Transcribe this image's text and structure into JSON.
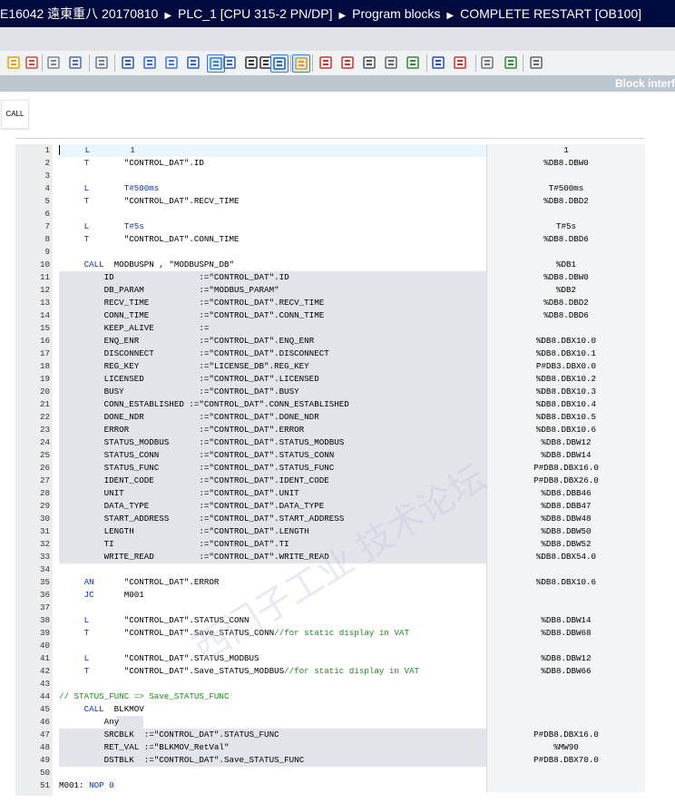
{
  "breadcrumb": [
    "E16042 遠東重八 20170810",
    "PLC_1 [CPU 315-2 PN/DP]",
    "Program blocks",
    "COMPLETE RESTART [OB100]"
  ],
  "block_interface_label": "Block interf",
  "favorites": {
    "call_label": "CALL"
  },
  "toolbar_icons": [
    "insert-network-icon",
    "delete-network-icon",
    "insert-row-icon",
    "comment-icon",
    "download-icon",
    "stl-list-icon",
    "view-a-icon",
    "view-b-icon",
    "view-c-icon",
    "speech-icon",
    "jump-icon",
    "jump-down-icon",
    "lines-icon",
    "lines-sel-icon",
    "goto-icon",
    "bp-set-icon",
    "bp-clear-icon",
    "monitor-icon",
    "watch-icon",
    "check-icon",
    "insert-label-icon",
    "branch-icon",
    "tool-icon",
    "sim-icon",
    "collapse-icon"
  ],
  "lines": [
    {
      "n": "1",
      "t": [
        [
          "L",
          "op"
        ],
        [
          "        1",
          "lit"
        ]
      ],
      "v": "1",
      "pad": "     "
    },
    {
      "n": "2",
      "t": [
        [
          "T",
          "op"
        ],
        [
          "       \"CONTROL_DAT\".ID",
          ""
        ]
      ],
      "v": "%DB8.DBW0",
      "pad": "     "
    },
    {
      "n": "3",
      "t": [],
      "v": "",
      "pad": ""
    },
    {
      "n": "4",
      "t": [
        [
          "L",
          "op"
        ],
        [
          "       T#500ms",
          "lit"
        ]
      ],
      "v": "T#500ms",
      "pad": "     "
    },
    {
      "n": "5",
      "t": [
        [
          "T",
          "op"
        ],
        [
          "       \"CONTROL_DAT\".RECV_TIME",
          ""
        ]
      ],
      "v": "%DB8.DBD2",
      "pad": "     "
    },
    {
      "n": "6",
      "t": [],
      "v": "",
      "pad": ""
    },
    {
      "n": "7",
      "t": [
        [
          "L",
          "op"
        ],
        [
          "       T#5s",
          "lit"
        ]
      ],
      "v": "T#5s",
      "pad": "     "
    },
    {
      "n": "8",
      "t": [
        [
          "T",
          "op"
        ],
        [
          "       \"CONTROL_DAT\".CONN_TIME",
          ""
        ]
      ],
      "v": "%DB8.DBD6",
      "pad": "     "
    },
    {
      "n": "9",
      "t": [],
      "v": "",
      "pad": ""
    },
    {
      "n": "10",
      "t": [
        [
          "CALL",
          "op"
        ],
        [
          "  MODBUSPN , \"MODBUSPN_DB\"",
          ""
        ]
      ],
      "v": "%DB1",
      "pad": "     "
    },
    {
      "n": "11",
      "t": [
        [
          "ID                 :=\"CONTROL_DAT\".ID",
          ""
        ]
      ],
      "v": "%DB8.DBW0",
      "pad": "         ",
      "hl": true
    },
    {
      "n": "12",
      "t": [
        [
          "DB_PARAM           :=\"MODBUS_PARAM\"",
          ""
        ]
      ],
      "v": "%DB2",
      "pad": "         ",
      "hl": true
    },
    {
      "n": "13",
      "t": [
        [
          "RECV_TIME          :=\"CONTROL_DAT\".RECV_TIME",
          ""
        ]
      ],
      "v": "%DB8.DBD2",
      "pad": "         ",
      "hl": true
    },
    {
      "n": "14",
      "t": [
        [
          "CONN_TIME          :=\"CONTROL_DAT\".CONN_TIME",
          ""
        ]
      ],
      "v": "%DB8.DBD6",
      "pad": "         ",
      "hl": true
    },
    {
      "n": "15",
      "t": [
        [
          "KEEP_ALIVE         :=",
          ""
        ]
      ],
      "v": "",
      "pad": "         ",
      "hl": true
    },
    {
      "n": "16",
      "t": [
        [
          "ENQ_ENR            :=\"CONTROL_DAT\".ENQ_ENR",
          ""
        ]
      ],
      "v": "%DB8.DBX10.0",
      "pad": "         ",
      "hl": true
    },
    {
      "n": "17",
      "t": [
        [
          "DISCONNECT         :=\"CONTROL_DAT\".DISCONNECT",
          ""
        ]
      ],
      "v": "%DB8.DBX10.1",
      "pad": "         ",
      "hl": true
    },
    {
      "n": "18",
      "t": [
        [
          "REG_KEY            :=\"LICENSE_DB\".REG_KEY",
          ""
        ]
      ],
      "v": "P#DB3.DBX0.0",
      "pad": "         ",
      "hl": true
    },
    {
      "n": "19",
      "t": [
        [
          "LICENSED           :=\"CONTROL_DAT\".LICENSED",
          ""
        ]
      ],
      "v": "%DB8.DBX10.2",
      "pad": "         ",
      "hl": true
    },
    {
      "n": "20",
      "t": [
        [
          "BUSY               :=\"CONTROL_DAT\".BUSY",
          ""
        ]
      ],
      "v": "%DB8.DBX10.3",
      "pad": "         ",
      "hl": true
    },
    {
      "n": "21",
      "t": [
        [
          "CONN_ESTABLISHED :=\"CONTROL_DAT\".CONN_ESTABLISHED",
          ""
        ]
      ],
      "v": "%DB8.DBX10.4",
      "pad": "         ",
      "hl": true
    },
    {
      "n": "22",
      "t": [
        [
          "DONE_NDR           :=\"CONTROL_DAT\".DONE_NDR",
          ""
        ]
      ],
      "v": "%DB8.DBX10.5",
      "pad": "         ",
      "hl": true
    },
    {
      "n": "23",
      "t": [
        [
          "ERROR              :=\"CONTROL_DAT\".ERROR",
          ""
        ]
      ],
      "v": "%DB8.DBX10.6",
      "pad": "         ",
      "hl": true
    },
    {
      "n": "24",
      "t": [
        [
          "STATUS_MODBUS      :=\"CONTROL_DAT\".STATUS_MODBUS",
          ""
        ]
      ],
      "v": "%DB8.DBW12",
      "pad": "         ",
      "hl": true
    },
    {
      "n": "25",
      "t": [
        [
          "STATUS_CONN        :=\"CONTROL_DAT\".STATUS_CONN",
          ""
        ]
      ],
      "v": "%DB8.DBW14",
      "pad": "         ",
      "hl": true
    },
    {
      "n": "26",
      "t": [
        [
          "STATUS_FUNC        :=\"CONTROL_DAT\".STATUS_FUNC",
          ""
        ]
      ],
      "v": "P#DB8.DBX16.0",
      "pad": "         ",
      "hl": true
    },
    {
      "n": "27",
      "t": [
        [
          "IDENT_CODE         :=\"CONTROL_DAT\".IDENT_CODE",
          ""
        ]
      ],
      "v": "P#DB8.DBX26.0",
      "pad": "         ",
      "hl": true
    },
    {
      "n": "28",
      "t": [
        [
          "UNIT               :=\"CONTROL_DAT\".UNIT",
          ""
        ]
      ],
      "v": "%DB8.DBB46",
      "pad": "         ",
      "hl": true
    },
    {
      "n": "29",
      "t": [
        [
          "DATA_TYPE          :=\"CONTROL_DAT\".DATA_TYPE",
          ""
        ]
      ],
      "v": "%DB8.DBB47",
      "pad": "         ",
      "hl": true
    },
    {
      "n": "30",
      "t": [
        [
          "START_ADDRESS      :=\"CONTROL_DAT\".START_ADDRESS",
          ""
        ]
      ],
      "v": "%DB8.DBW48",
      "pad": "         ",
      "hl": true
    },
    {
      "n": "31",
      "t": [
        [
          "LENGTH             :=\"CONTROL_DAT\".LENGTH",
          ""
        ]
      ],
      "v": "%DB8.DBW50",
      "pad": "         ",
      "hl": true
    },
    {
      "n": "32",
      "t": [
        [
          "TI                 :=\"CONTROL_DAT\".TI",
          ""
        ]
      ],
      "v": "%DB8.DBW52",
      "pad": "         ",
      "hl": true
    },
    {
      "n": "33",
      "t": [
        [
          "WRITE_READ         :=\"CONTROL_DAT\".WRITE_READ",
          ""
        ]
      ],
      "v": "%DB8.DBX54.0",
      "pad": "         ",
      "hl": true
    },
    {
      "n": "34",
      "t": [],
      "v": "",
      "pad": ""
    },
    {
      "n": "35",
      "t": [
        [
          "AN",
          "op"
        ],
        [
          "      \"CONTROL_DAT\".ERROR",
          ""
        ]
      ],
      "v": "%DB8.DBX10.6",
      "pad": "     "
    },
    {
      "n": "36",
      "t": [
        [
          "JC",
          "op"
        ],
        [
          "      M001",
          ""
        ]
      ],
      "v": "",
      "pad": "     "
    },
    {
      "n": "37",
      "t": [],
      "v": "",
      "pad": ""
    },
    {
      "n": "38",
      "t": [
        [
          "L",
          "op"
        ],
        [
          "       \"CONTROL_DAT\".STATUS_CONN",
          ""
        ]
      ],
      "v": "%DB8.DBW14",
      "pad": "     "
    },
    {
      "n": "39",
      "t": [
        [
          "T",
          "op"
        ],
        [
          "       \"CONTROL_DAT\".Save_STATUS_CONN",
          ""
        ],
        [
          "//for static display in VAT",
          "cmt"
        ]
      ],
      "v": "%DB8.DBW68",
      "pad": "     "
    },
    {
      "n": "40",
      "t": [],
      "v": "",
      "pad": ""
    },
    {
      "n": "41",
      "t": [
        [
          "L",
          "op"
        ],
        [
          "       \"CONTROL_DAT\".STATUS_MODBUS",
          ""
        ]
      ],
      "v": "%DB8.DBW12",
      "pad": "     "
    },
    {
      "n": "42",
      "t": [
        [
          "T",
          "op"
        ],
        [
          "       \"CONTROL_DAT\".Save_STATUS_MODBUS",
          ""
        ],
        [
          "//for static display in VAT",
          "cmt"
        ]
      ],
      "v": "%DB8.DBW66",
      "pad": "     "
    },
    {
      "n": "43",
      "t": [],
      "v": "",
      "pad": ""
    },
    {
      "n": "44",
      "t": [
        [
          "// STATUS_FUNC => Save_STATUS_FUNC",
          "cmt"
        ]
      ],
      "v": "",
      "pad": ""
    },
    {
      "n": "45",
      "t": [
        [
          "CALL",
          "op"
        ],
        [
          "  BLKMOV",
          ""
        ]
      ],
      "v": "",
      "pad": "     "
    },
    {
      "n": "46",
      "t": [
        [
          "Any",
          ""
        ]
      ],
      "v": "",
      "pad": "         ",
      "hl2": true
    },
    {
      "n": "47",
      "t": [
        [
          "SRCBLK  :=\"CONTROL_DAT\".STATUS_FUNC",
          ""
        ]
      ],
      "v": "P#DB8.DBX16.0",
      "pad": "         ",
      "hl": true
    },
    {
      "n": "48",
      "t": [
        [
          "RET_VAL :=\"BLKMOV_RetVal\"",
          ""
        ]
      ],
      "v": "%MW90",
      "pad": "         ",
      "hl": true
    },
    {
      "n": "49",
      "t": [
        [
          "DSTBLK  :=\"CONTROL_DAT\".Save_STATUS_FUNC",
          ""
        ]
      ],
      "v": "P#DB8.DBX70.0",
      "pad": "         ",
      "hl": true
    },
    {
      "n": "50",
      "t": [],
      "v": "",
      "pad": ""
    },
    {
      "n": "51",
      "t": [
        [
          "M001: ",
          ""
        ],
        [
          "NOP",
          "op"
        ],
        [
          " 0",
          "lit"
        ]
      ],
      "v": "",
      "pad": ""
    }
  ]
}
